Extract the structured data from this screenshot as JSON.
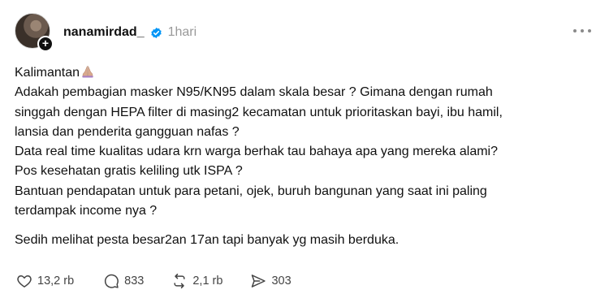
{
  "post": {
    "username": "nanamirdad_",
    "timestamp": "1hari",
    "lines": [
      "Kalimantan",
      "Adakah pembagian masker N95/KN95 dalam skala besar ? Gimana dengan rumah",
      "singgah dengan HEPA filter di masing2 kecamatan untuk prioritaskan bayi, ibu hamil,",
      "lansia dan penderita gangguan nafas ?",
      "Data real time kualitas udara krn warga berhak tau bahaya apa yang mereka alami?",
      "Pos kesehatan gratis keliling utk ISPA ?",
      "Bantuan pendapatan untuk para petani, ojek, buruh bangunan yang saat ini paling",
      "terdampak income nya ?",
      "Sedih melihat pesta besar2an 17an tapi banyak yg masih berduka."
    ],
    "emoji": "praying-hands",
    "actions": {
      "likes": "13,2 rb",
      "comments": "833",
      "reposts": "2,1 rb",
      "shares": "303"
    }
  },
  "colors": {
    "text": "#101010",
    "muted": "#999999",
    "verified": "#0095f6"
  },
  "icons": {
    "verified": "verified-badge-icon",
    "more": "more-options-icon",
    "like": "heart-icon",
    "comment": "comment-icon",
    "repost": "repost-icon",
    "share": "share-icon"
  }
}
